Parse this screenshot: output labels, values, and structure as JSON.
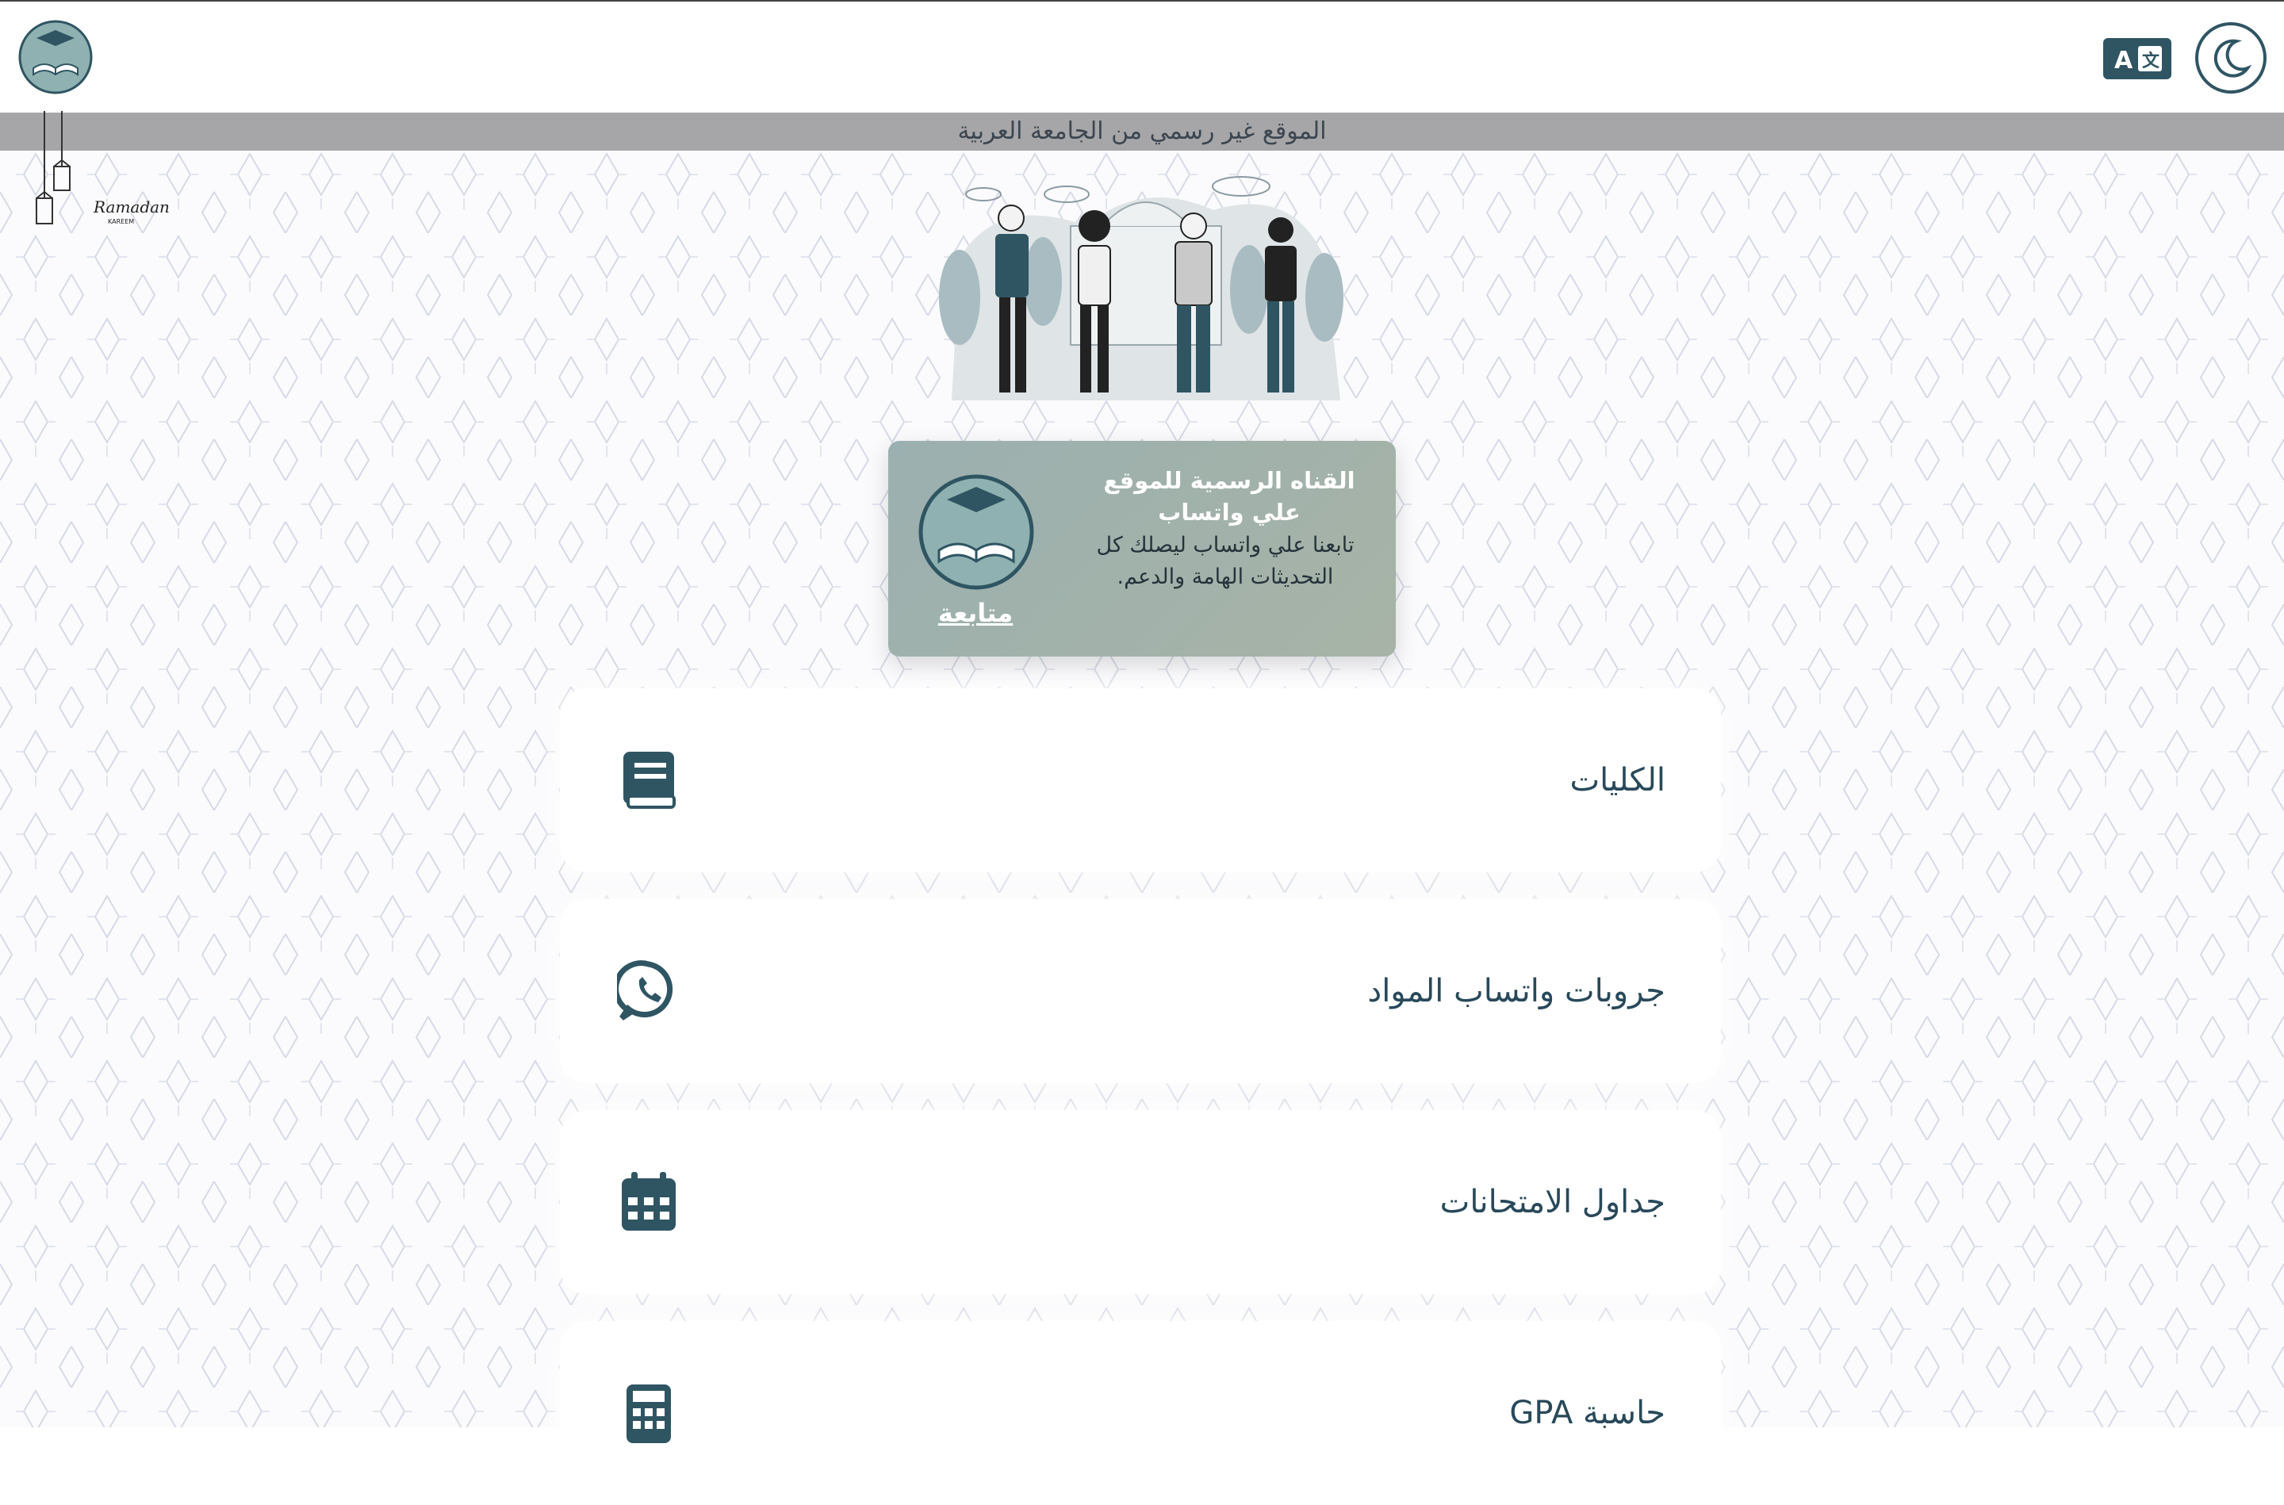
{
  "header": {
    "logo_icon": "graduation-book-logo",
    "translate_icon": "translate-icon",
    "theme_icon": "moon-icon"
  },
  "notice": {
    "text": "الموقع غير رسمي من الجامعة العربية"
  },
  "decoration": {
    "ramadan_text": "Ramadan",
    "ramadan_sub": "KAREEM"
  },
  "channel": {
    "title": "القناه الرسمية للموقع علي واتساب",
    "description": "تابعنا علي واتساب ليصلك كل التحديثات الهامة والدعم.",
    "follow_label": "متابعة"
  },
  "menu": [
    {
      "label": "الكليات",
      "icon": "book-icon"
    },
    {
      "label": "جروبات واتساب المواد",
      "icon": "whatsapp-icon"
    },
    {
      "label": "جداول الامتحانات",
      "icon": "calendar-icon"
    },
    {
      "label": "حاسبة GPA",
      "icon": "calculator-icon"
    }
  ],
  "colors": {
    "primary": "#2f5563",
    "notice_bg": "#a6a6a8",
    "card_bg": "#9fb1ad"
  }
}
